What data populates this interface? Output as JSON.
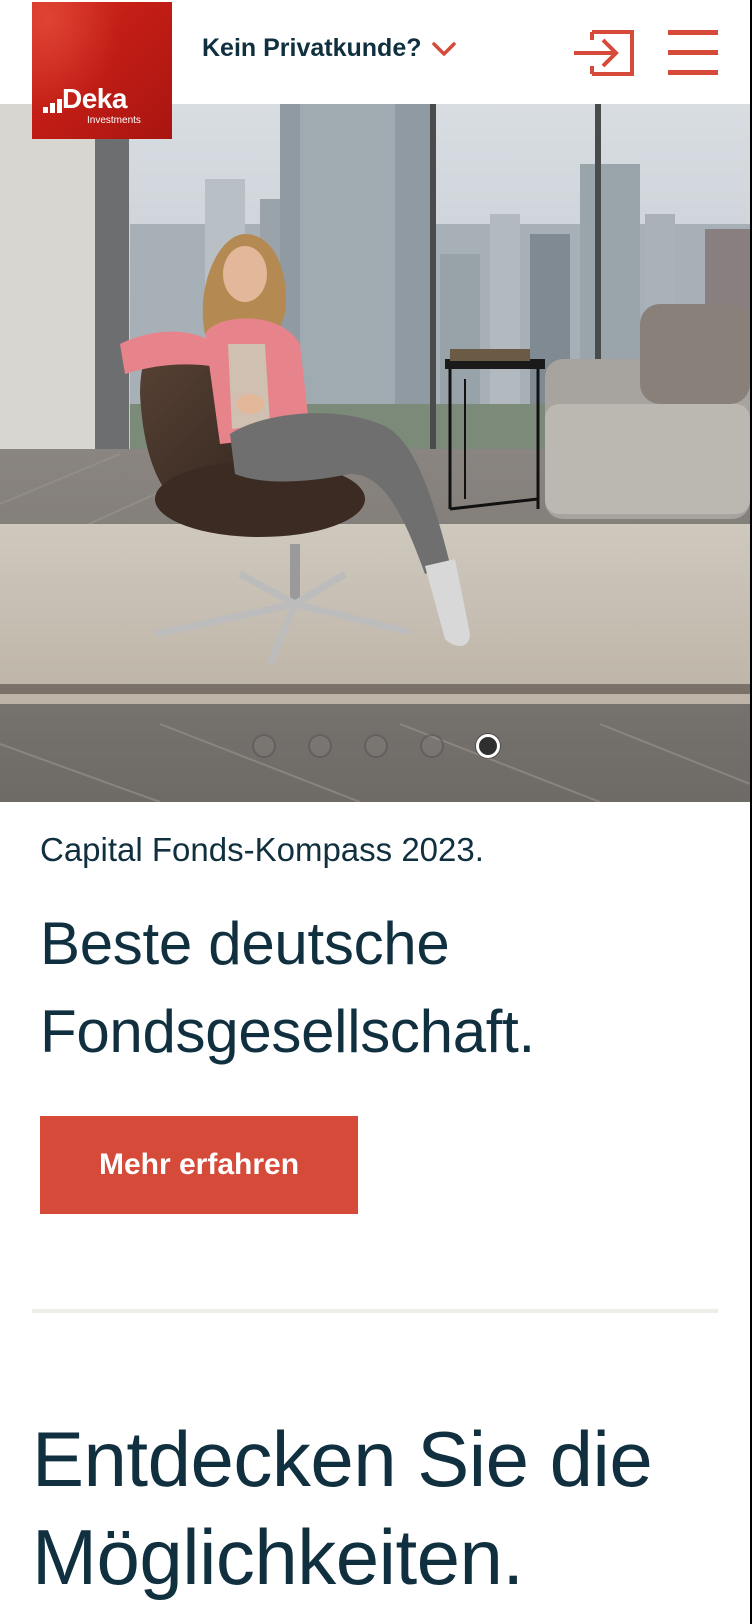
{
  "header": {
    "logo": {
      "name": "Deka",
      "sub": "Investments"
    },
    "customer_toggle": "Kein Privatkunde?",
    "login_icon": "login-arrow-icon",
    "menu_icon": "hamburger-menu-icon",
    "accent_color": "#d64a3a"
  },
  "hero": {
    "slides_total": 5,
    "active_slide": 5
  },
  "teaser": {
    "kicker": "Capital Fonds-Kompass 2023.",
    "headline_line1": "Beste deutsche",
    "headline_line2": "Fondsgesellschaft.",
    "cta_label": "Mehr erfahren"
  },
  "section": {
    "title_line1": "Entdecken Sie die",
    "title_line2": "Möglichkeiten."
  }
}
